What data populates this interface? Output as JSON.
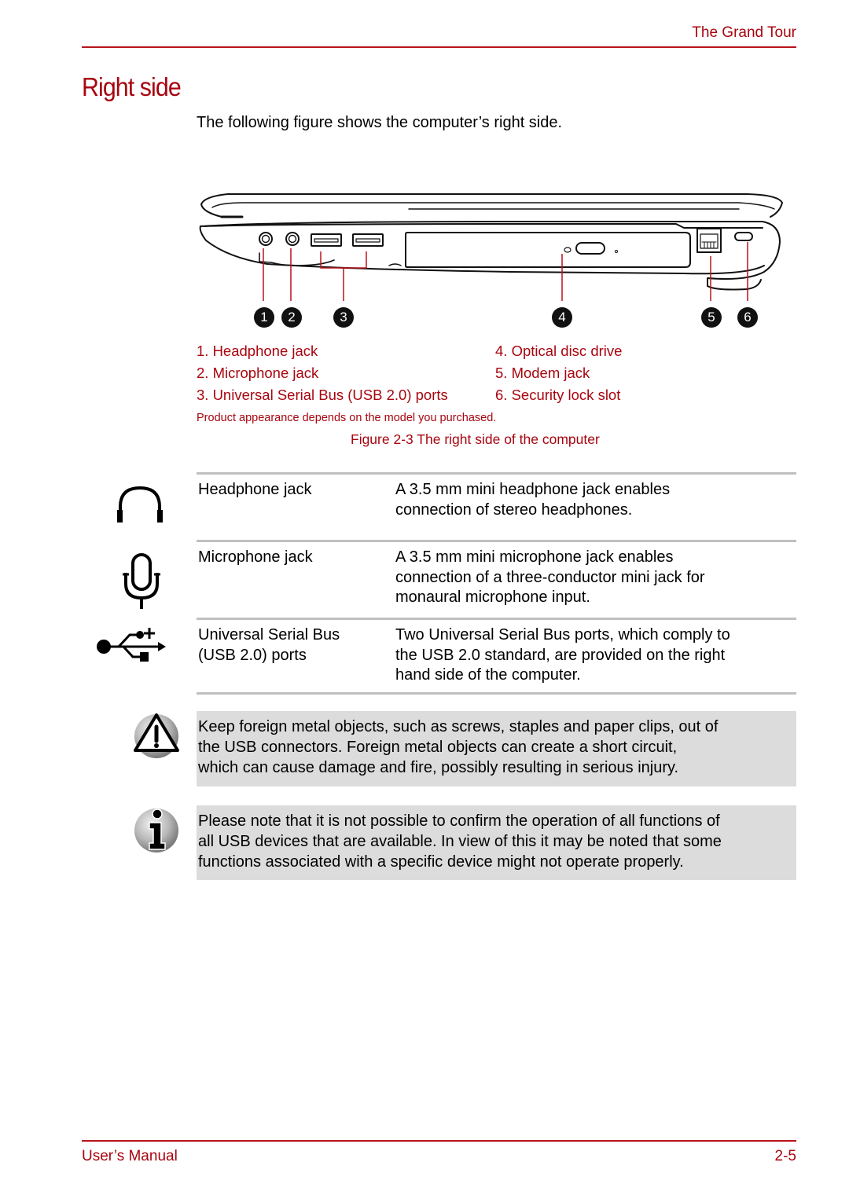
{
  "header": {
    "chapter": "The Grand Tour"
  },
  "section": {
    "title": "Right side",
    "intro": "The following figure shows the computer’s right side."
  },
  "figure": {
    "markers": [
      "1",
      "2",
      "3",
      "4",
      "5",
      "6"
    ],
    "legend": [
      "1. Headphone jack",
      "2. Microphone jack",
      "3. Universal Serial Bus (USB 2.0) ports",
      "4. Optical disc drive",
      "5. Modem jack",
      "6. Security lock slot"
    ],
    "product_note": "Product appearance depends on the model you purchased.",
    "caption": "Figure 2-3 The right side of the computer"
  },
  "table": {
    "rows": [
      {
        "icon": "headphone-icon",
        "term": [
          "Headphone jack"
        ],
        "desc": [
          "A 3.5 mm mini headphone jack enables",
          "connection of stereo headphones."
        ]
      },
      {
        "icon": "microphone-icon",
        "term": [
          "Microphone jack"
        ],
        "desc": [
          "A 3.5 mm mini microphone jack enables",
          "connection of a three-conductor mini jack for",
          "monaural microphone input."
        ]
      },
      {
        "icon": "usb-icon",
        "term": [
          "Universal Serial Bus",
          "(USB 2.0) ports"
        ],
        "desc": [
          "Two Universal Serial Bus ports, which comply to",
          "the USB 2.0 standard, are provided on the right",
          "hand side of the computer."
        ]
      }
    ]
  },
  "notes": [
    {
      "icon": "warning-icon",
      "lines": [
        "Keep foreign metal objects, such as screws, staples and paper clips, out of",
        "the USB connectors. Foreign metal objects can create a short circuit,",
        "which can cause damage and fire, possibly resulting in serious injury."
      ]
    },
    {
      "icon": "info-icon",
      "lines": [
        "Please note that it is not possible to confirm the operation of all functions of",
        "all USB devices that are available. In view of this it may be noted that some",
        "functions associated with a specific device might not operate properly."
      ]
    }
  ],
  "footer": {
    "manual": "User’s Manual",
    "page": "2-5"
  },
  "colors": {
    "accent": "#a8050f",
    "rule": "#b8131c",
    "note_bg": "#dcdcdc",
    "table_rule": "#c0c0c0"
  }
}
